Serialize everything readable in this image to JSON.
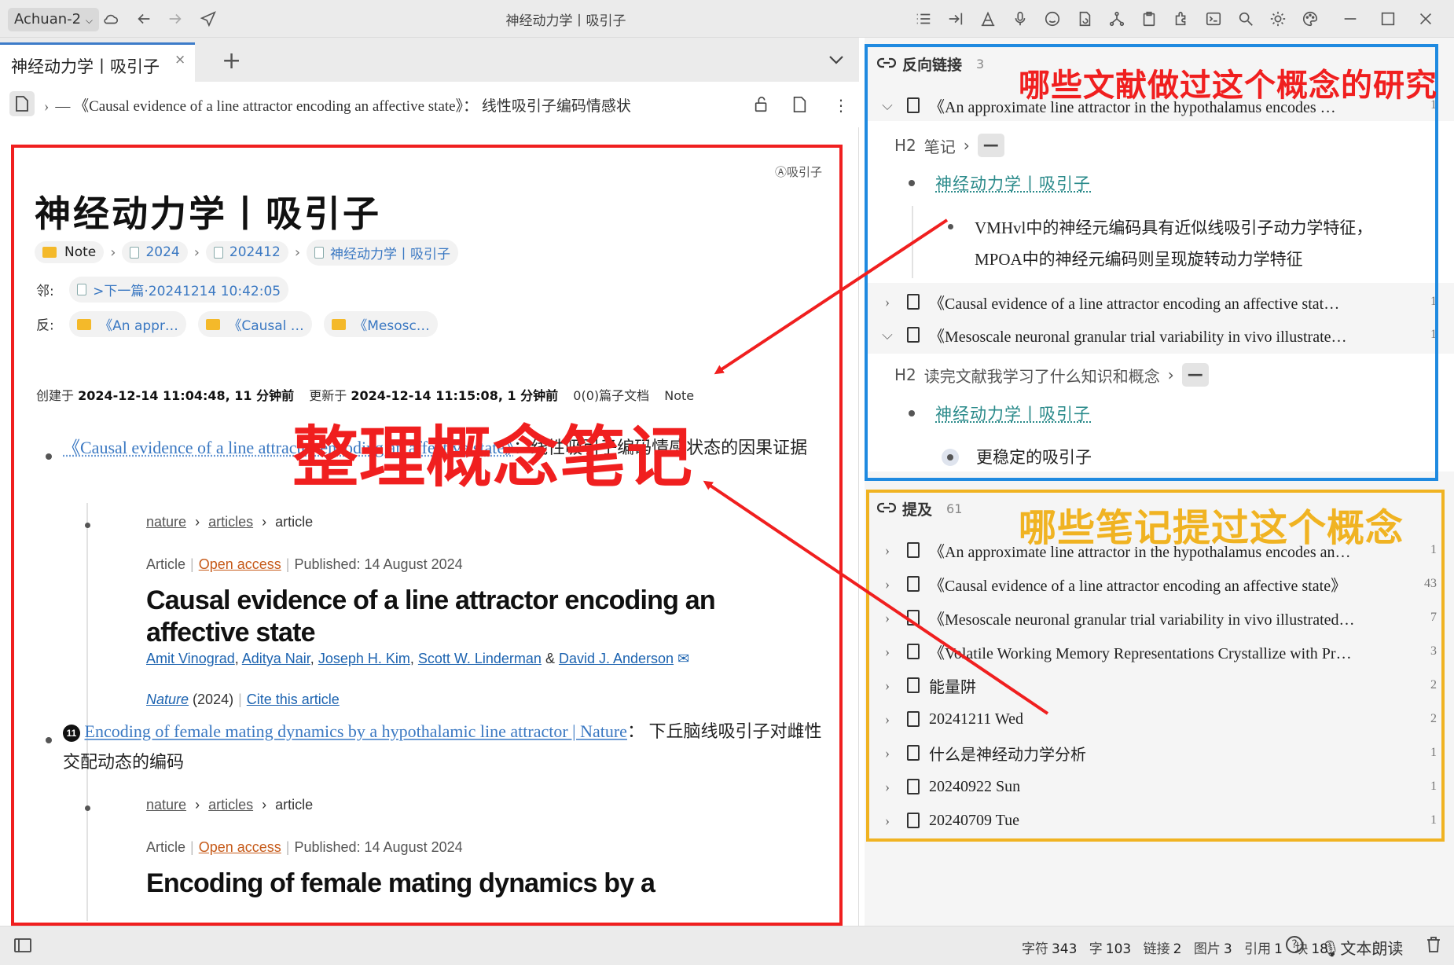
{
  "window": {
    "workspace": "Achuan-2",
    "title": "神经动力学丨吸引子"
  },
  "tabs": {
    "active_label": "神经动力学丨吸引子",
    "close_glyph": "×",
    "add_glyph": "+"
  },
  "breadcrumb": {
    "text": "— 《Causal evidence of a line attractor encoding an affective state》： 线性吸引子编码情感状"
  },
  "doc": {
    "attr_tag": "Ⓐ吸引子",
    "title": "神经动力学丨吸引子",
    "path": [
      "Note",
      "2024",
      "202412",
      "神经动力学丨吸引子"
    ],
    "neighbor_label": "邻:",
    "neighbor_value": ">下一篇·20241214 10:42:05",
    "backlinks_label": "反:",
    "backlink_chips": [
      "《An appr…",
      "《Causal …",
      "《Mesosc…"
    ],
    "created_label": "创建于",
    "created_value": "2024-12-14 11:04:48, 11 分钟前",
    "updated_label": "更新于",
    "updated_value": "2024-12-14 11:15:08, 1 分钟前",
    "subdocs": "0(0)篇子文档",
    "notebook": "Note",
    "item1_link": "《Causal evidence of a line attractor encoding an affective state》",
    "item1_rest": "：线性吸引子编码情感状态的因果证据",
    "item2_badge": "11",
    "item2_link": "Encoding of female mating dynamics by a hypothalamic line attractor | Nature",
    "item2_rest": "： 下丘脑线吸引子对雌性交配动态的编码",
    "nature_crumb": [
      "nature",
      "articles",
      "article"
    ],
    "article_type": "Article",
    "open_access": "Open access",
    "published": "Published: 14 August 2024",
    "article1_title": "Causal evidence of a line attractor encoding an affective state",
    "authors": [
      "Amit Vinograd",
      "Aditya Nair",
      "Joseph H. Kim",
      "Scott W. Linderman",
      "David J. Anderson"
    ],
    "journal": "Nature",
    "year": "(2024)",
    "cite": "Cite this article",
    "article2_title": "Encoding of female mating dynamics by a"
  },
  "backlinks_panel": {
    "label": "反向链接",
    "count": "3",
    "rows": [
      {
        "text": "《An approximate line attractor in the hypothalamus encodes …",
        "count": "1",
        "expanded": true
      },
      {
        "text": "《Causal evidence of a line attractor encoding an affective stat…",
        "count": "1",
        "expanded": false
      },
      {
        "text": "《Mesoscale neuronal granular trial variability in vivo illustrate…",
        "count": "1",
        "expanded": true
      }
    ],
    "h2_a": "笔记",
    "link_a": "神经动力学丨吸引子",
    "text_a": "VMHvl中的神经元编码具有近似线吸引子动力学特征，MPOA中的神经元编码则呈现旋转动力学特征",
    "h2_b": "读完文献我学习了什么知识和概念",
    "link_b": "神经动力学丨吸引子",
    "text_b": "更稳定的吸引子",
    "h2_prefix": "H2",
    "dash": "—"
  },
  "mentions_panel": {
    "label": "提及",
    "count": "61",
    "rows": [
      {
        "text": "《An approximate line attractor in the hypothalamus encodes an…",
        "count": "1"
      },
      {
        "text": "《Causal evidence of a line attractor encoding an affective state》",
        "count": "43"
      },
      {
        "text": "《Mesoscale neuronal granular trial variability in vivo illustrated…",
        "count": "7"
      },
      {
        "text": "《Volatile Working Memory Representations Crystallize with Pr…",
        "count": "3"
      },
      {
        "text": "能量阱",
        "count": "2"
      },
      {
        "text": "20241211 Wed",
        "count": "2"
      },
      {
        "text": "什么是神经动力学分析",
        "count": "1"
      },
      {
        "text": "20240922 Sun",
        "count": "1"
      },
      {
        "text": "20240709 Tue",
        "count": "1"
      }
    ]
  },
  "status": {
    "chars_label": "字符",
    "chars": "343",
    "words_label": "字",
    "words": "103",
    "links_label": "链接",
    "links": "2",
    "images_label": "图片",
    "images": "3",
    "refs_label": "引用",
    "refs": "1",
    "blocks_label": "块",
    "blocks": "18",
    "tts": "文本朗读"
  },
  "annotations": {
    "center": "整理概念笔记",
    "top_right": "哪些文献做过这个概念的研究",
    "bottom_right": "哪些笔记提过这个概念",
    "colors": {
      "red": "#f01f1f",
      "blue": "#1f8ae0",
      "yellow": "#f0b322"
    }
  }
}
